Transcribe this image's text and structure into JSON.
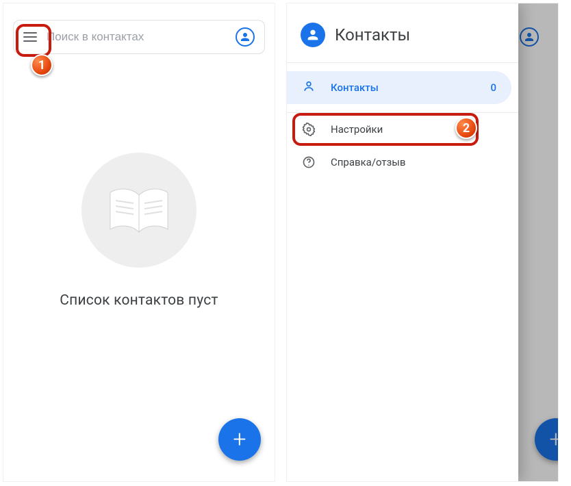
{
  "left": {
    "search_placeholder": "Поиск в контактах",
    "empty_message": "Список контактов пуст"
  },
  "right": {
    "drawer": {
      "title": "Контакты",
      "contacts_item": {
        "label": "Контакты",
        "count": "0"
      },
      "settings_label": "Настройки",
      "help_label": "Справка/отзыв"
    }
  },
  "markers": {
    "one": "1",
    "two": "2"
  }
}
